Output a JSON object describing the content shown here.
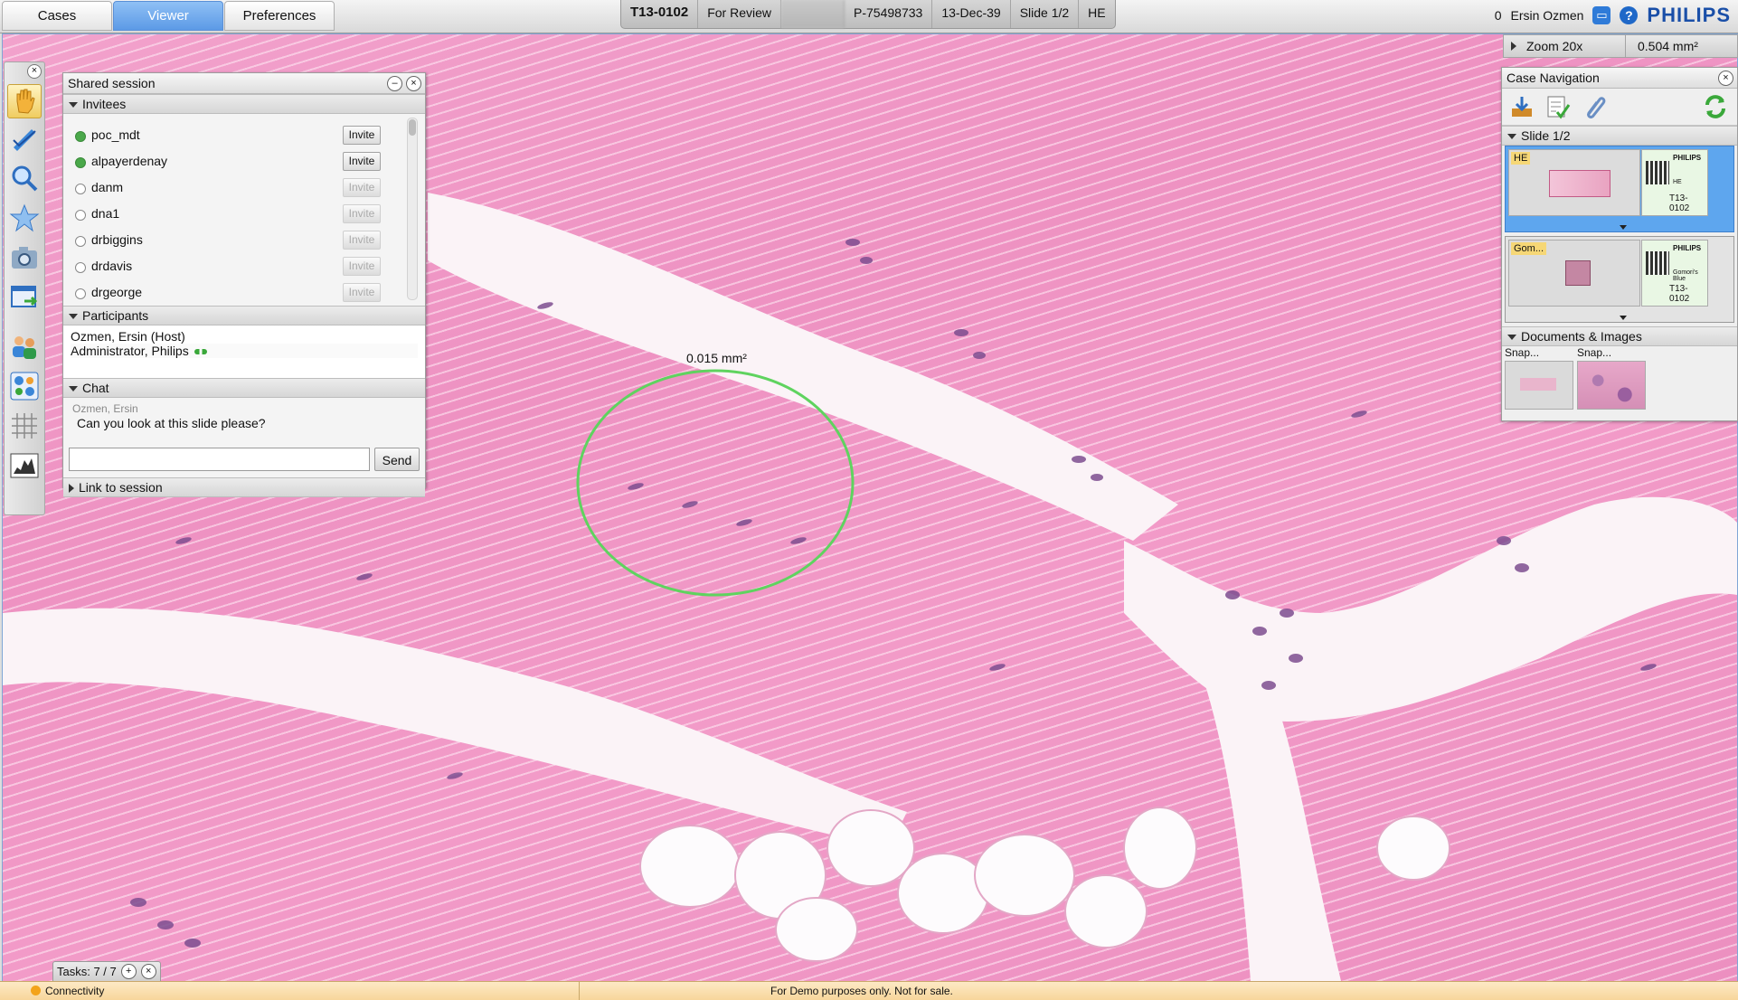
{
  "tabs": [
    {
      "label": "Cases",
      "active": false
    },
    {
      "label": "Viewer",
      "active": true
    },
    {
      "label": "Preferences",
      "active": false
    }
  ],
  "case_bar": {
    "case_id": "T13-0102",
    "status": "For Review",
    "patient_id": "P-75498733",
    "date": "13-Dec-39",
    "slide": "Slide 1/2",
    "stain": "HE"
  },
  "top_right": {
    "count": "0",
    "user": "Ersin Ozmen",
    "brand": "PHILIPS",
    "icons": [
      "monitor-icon",
      "help-icon"
    ]
  },
  "shared_session": {
    "title": "Shared session",
    "invitees_header": "Invitees",
    "invitees": [
      {
        "name": "poc_mdt",
        "online": true,
        "button": "Invite"
      },
      {
        "name": "alpayerdenay",
        "online": true,
        "button": "Invite"
      },
      {
        "name": "danm",
        "online": false,
        "button": "Invite"
      },
      {
        "name": "dna1",
        "online": false,
        "button": "Invite"
      },
      {
        "name": "drbiggins",
        "online": false,
        "button": "Invite"
      },
      {
        "name": "drdavis",
        "online": false,
        "button": "Invite"
      },
      {
        "name": "drgeorge",
        "online": false,
        "button": "Invite"
      }
    ],
    "participants_header": "Participants",
    "participant_host": "Ozmen, Ersin (Host)",
    "participant_role": "Administrator, Philips",
    "chat_header": "Chat",
    "chat_author": "Ozmen, Ersin",
    "chat_message": "Can you look at this slide please?",
    "chat_input_value": "",
    "send_label": "Send",
    "link_header": "Link to session"
  },
  "annotation": {
    "area_label": "0.015 mm²",
    "color": "#5fd35f"
  },
  "zoom": {
    "level": "Zoom 20x",
    "area": "0.504 mm²"
  },
  "case_navigation": {
    "title": "Case Navigation",
    "slide_header": "Slide 1/2",
    "slides": [
      {
        "stain": "HE",
        "label_brand": "PHILIPS",
        "label_id": "T13-0102",
        "label_sub": "HE",
        "selected": true
      },
      {
        "stain": "Gom...",
        "label_brand": "PHILIPS",
        "label_id": "T13-0102",
        "label_sub": "Gomori's Blue",
        "selected": false
      }
    ],
    "docs_header": "Documents & Images",
    "docs": [
      {
        "label": "Snap..."
      },
      {
        "label": "Snap..."
      }
    ]
  },
  "tasks": {
    "label": "Tasks: 7 / 7"
  },
  "status_bar": {
    "connectivity": "Connectivity",
    "demo_notice": "For Demo purposes only. Not for sale."
  },
  "colors": {
    "accent_blue": "#5c9ae6",
    "tissue_pink": "#ef97c5",
    "status_orange": "#f3a31b"
  }
}
